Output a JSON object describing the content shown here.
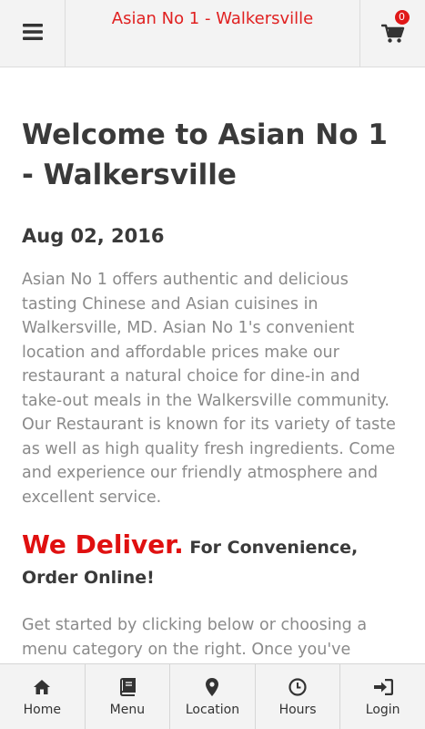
{
  "header": {
    "title": "Asian No 1 - Walkersville",
    "menu_icon": "hamburger-menu-icon",
    "cart_icon": "shopping-cart-icon",
    "cart_count": "0"
  },
  "main": {
    "heading": "Welcome to Asian No 1 - Walkersville",
    "date": "Aug 02, 2016",
    "intro": "Asian No 1 offers authentic and delicious tasting Chinese and Asian cuisines in Walkersville, MD. Asian No 1's convenient location and affordable prices make our restaurant a natural choice for dine-in and take-out meals in the Walkersville community. Our Restaurant is known for its variety of taste as well as high quality fresh ingredients. Come and experience our friendly atmosphere and excellent service.",
    "deliver_highlight": "We Deliver.",
    "deliver_rest": "For Convenience, Order Online!",
    "get_started": "Get started by clicking below or choosing a menu category on the right. Once you've selected the items you wish to order, you will"
  },
  "bottom_nav": {
    "items": [
      {
        "label": "Home",
        "icon": "home-icon"
      },
      {
        "label": "Menu",
        "icon": "book-icon"
      },
      {
        "label": "Location",
        "icon": "map-marker-icon"
      },
      {
        "label": "Hours",
        "icon": "clock-icon"
      },
      {
        "label": "Login",
        "icon": "sign-in-icon"
      }
    ]
  },
  "colors": {
    "accent_red": "#e01010",
    "header_bg": "#f3f3f3",
    "heading_text": "#3a3a3a",
    "body_text": "#8a8a8a"
  }
}
